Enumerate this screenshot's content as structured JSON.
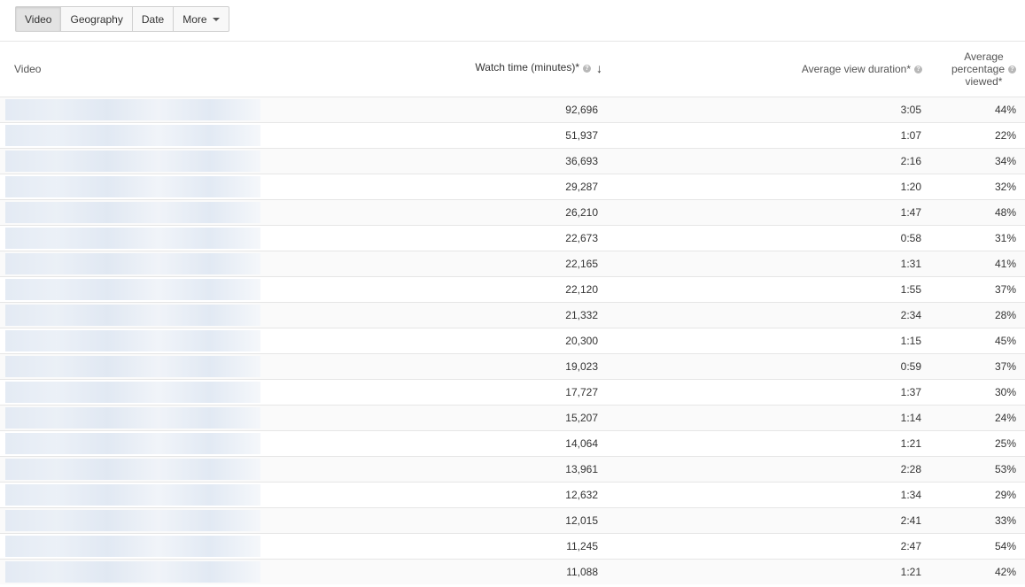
{
  "tabs": [
    {
      "label": "Video",
      "active": true
    },
    {
      "label": "Geography",
      "active": false
    },
    {
      "label": "Date",
      "active": false
    },
    {
      "label": "More",
      "active": false
    }
  ],
  "columns": {
    "video": "Video",
    "watch_time": "Watch time (minutes)*",
    "avg_duration": "Average view duration*",
    "avg_pct_line1": "Average",
    "avg_pct_line2": "percentage",
    "avg_pct_line3": "viewed*"
  },
  "rows": [
    {
      "watch": "92,696",
      "duration": "3:05",
      "pct": "44%"
    },
    {
      "watch": "51,937",
      "duration": "1:07",
      "pct": "22%"
    },
    {
      "watch": "36,693",
      "duration": "2:16",
      "pct": "34%"
    },
    {
      "watch": "29,287",
      "duration": "1:20",
      "pct": "32%"
    },
    {
      "watch": "26,210",
      "duration": "1:47",
      "pct": "48%"
    },
    {
      "watch": "22,673",
      "duration": "0:58",
      "pct": "31%"
    },
    {
      "watch": "22,165",
      "duration": "1:31",
      "pct": "41%"
    },
    {
      "watch": "22,120",
      "duration": "1:55",
      "pct": "37%"
    },
    {
      "watch": "21,332",
      "duration": "2:34",
      "pct": "28%"
    },
    {
      "watch": "20,300",
      "duration": "1:15",
      "pct": "45%"
    },
    {
      "watch": "19,023",
      "duration": "0:59",
      "pct": "37%"
    },
    {
      "watch": "17,727",
      "duration": "1:37",
      "pct": "30%"
    },
    {
      "watch": "15,207",
      "duration": "1:14",
      "pct": "24%"
    },
    {
      "watch": "14,064",
      "duration": "1:21",
      "pct": "25%"
    },
    {
      "watch": "13,961",
      "duration": "2:28",
      "pct": "53%"
    },
    {
      "watch": "12,632",
      "duration": "1:34",
      "pct": "29%"
    },
    {
      "watch": "12,015",
      "duration": "2:41",
      "pct": "33%"
    },
    {
      "watch": "11,245",
      "duration": "2:47",
      "pct": "54%"
    },
    {
      "watch": "11,088",
      "duration": "1:21",
      "pct": "42%"
    }
  ]
}
